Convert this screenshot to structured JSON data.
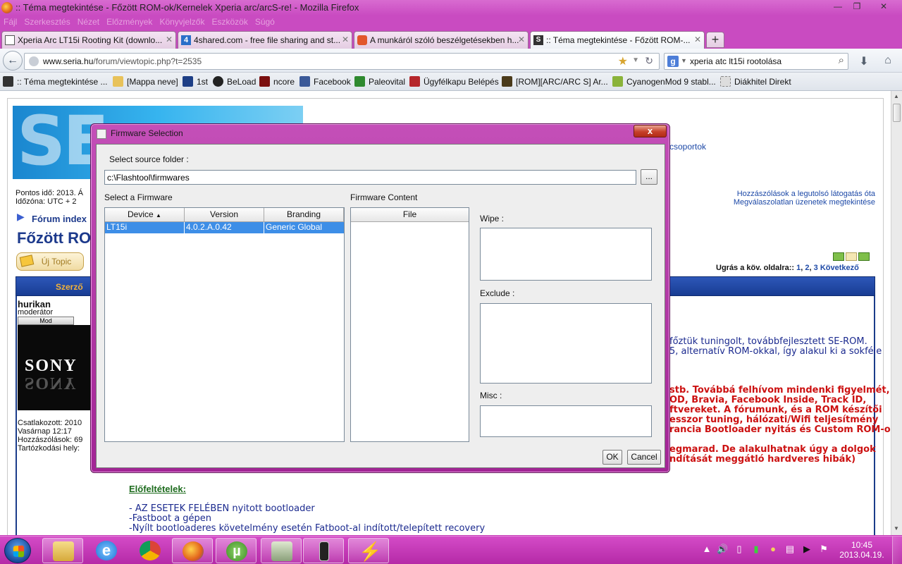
{
  "window": {
    "title": ":: Téma megtekintése - Főzött ROM-ok/Kernelek Xperia arc/arcS-re! - Mozilla Firefox",
    "controls": {
      "minimize": "—",
      "maximize": "❐",
      "close": "✕"
    }
  },
  "menu": [
    "Fájl",
    "Szerkesztés",
    "Nézet",
    "Előzmények",
    "Könyvjelzők",
    "Eszközök",
    "Súgó"
  ],
  "tabs": [
    {
      "label": "Xperia Arc LT15i Rooting Kit (downlo...",
      "icon": "page-icon",
      "active": false
    },
    {
      "label": "4shared.com - free file sharing and st...",
      "icon": "4shared-icon",
      "active": false
    },
    {
      "label": "A munkáról szóló beszélgetésekben h...",
      "icon": "site-icon",
      "active": false
    },
    {
      "label": ":: Téma megtekintése - Főzött ROM-...",
      "icon": "seria-icon",
      "active": true
    }
  ],
  "newtab_label": "+",
  "navigation": {
    "url_host": "www.seria.hu",
    "url_path": "/forum/viewtopic.php?t=2535",
    "search_engine": "g",
    "search_query": "xperia atc lt15i rootolása"
  },
  "bookmarks": [
    {
      "label": ":: Téma megtekintése ...",
      "color": "#333333"
    },
    {
      "label": "[Mappa neve]",
      "color": "#e8c25a"
    },
    {
      "label": "1st",
      "color": "#1e3f86"
    },
    {
      "label": "BeLoad",
      "color": "#222222"
    },
    {
      "label": "ncore",
      "color": "#7a0f0f"
    },
    {
      "label": "Facebook",
      "color": "#3b5998"
    },
    {
      "label": "Paleovital",
      "color": "#2f8a2f"
    },
    {
      "label": "Ügyfélkapu Belépés",
      "color": "#b5262b"
    },
    {
      "label": "[ROM][ARC/ARC S] Ar...",
      "color": "#4a3a1a"
    },
    {
      "label": "CyanogenMod 9 stabl...",
      "color": "#8ab33a"
    },
    {
      "label": "Diákhitel Direkt",
      "color": "#dddddd"
    }
  ],
  "page": {
    "time_line": "Pontos idő: 2013. Á",
    "timezone_line": "Időzóna: UTC + 2",
    "forum_index": "Fórum index",
    "topic_title": "Főzött ROM",
    "new_topic": "Új Topic",
    "top_right_link": "csoportok",
    "links_right": [
      "Hozzászólások a legutolsó látogatás óta",
      "Megválaszolatlan üzenetek megtekintése"
    ],
    "pagination": {
      "prefix": "Ugrás a köv. oldalra::",
      "pages": [
        "1",
        "2",
        "3"
      ],
      "next": "Következő"
    },
    "header_author": "Szerző",
    "author": {
      "name": "hurikan",
      "role": "moderátor",
      "badge": "Mod",
      "avatar_text": "SONY"
    },
    "author_info": [
      "Csatlakozott: 2010",
      "Vasárnap 12:17",
      "Hozzászólások: 69",
      "Tartózkodási hely:"
    ],
    "body_blue": [
      "főztük tuningolt, továbbfejlesztett SE-ROM.",
      "5, alternatív ROM-okkal, így alakul ki a sokféle"
    ],
    "body_red": [
      "stb. Továbbá felhívom mindenki figyelmét,",
      "OD, Bravia, Facebook Inside, Track ID,",
      "ftvereket. A fórumunk, és a ROM készítői",
      "esszor tuning, hálózati/Wifi teljesítmény",
      "rancia Bootloader nyitás és Custom ROM-ok",
      "egmarad. De alakulhatnak úgy a dolgok",
      "ndítását meggátló hardveres hibák)"
    ],
    "prereq_heading": "Előfeltételek:",
    "prereq_items": [
      "- AZ ESETEK FELÉBEN nyitott bootloader",
      "-Fastboot a gépen",
      "-Nyílt bootloaderes követelmény esetén Fatboot-al indított/telepített recovery"
    ]
  },
  "dialog": {
    "title": "Firmware Selection",
    "close": "x",
    "source_label": "Select source folder :",
    "source_path": "c:\\Flashtool\\firmwares",
    "browse": "...",
    "select_firmware_label": "Select a Firmware",
    "firmware_columns": [
      "Device",
      "Version",
      "Branding"
    ],
    "sort_indicator": "▲",
    "firmware_rows": [
      {
        "device": "LT15i",
        "version": "4.0.2.A.0.42",
        "branding": "Generic Global",
        "selected": true
      }
    ],
    "content_label": "Firmware Content",
    "content_column": "File",
    "wipe_label": "Wipe :",
    "exclude_label": "Exclude :",
    "misc_label": "Misc :",
    "ok": "OK",
    "cancel": "Cancel"
  },
  "taskbar": {
    "apps": [
      "explorer-icon",
      "ie-icon",
      "chrome-icon",
      "firefox-icon",
      "utorrent-icon",
      "system-icon",
      "phone-icon",
      "flashtool-icon"
    ],
    "clock_time": "10:45",
    "clock_date": "2013.04.19."
  }
}
